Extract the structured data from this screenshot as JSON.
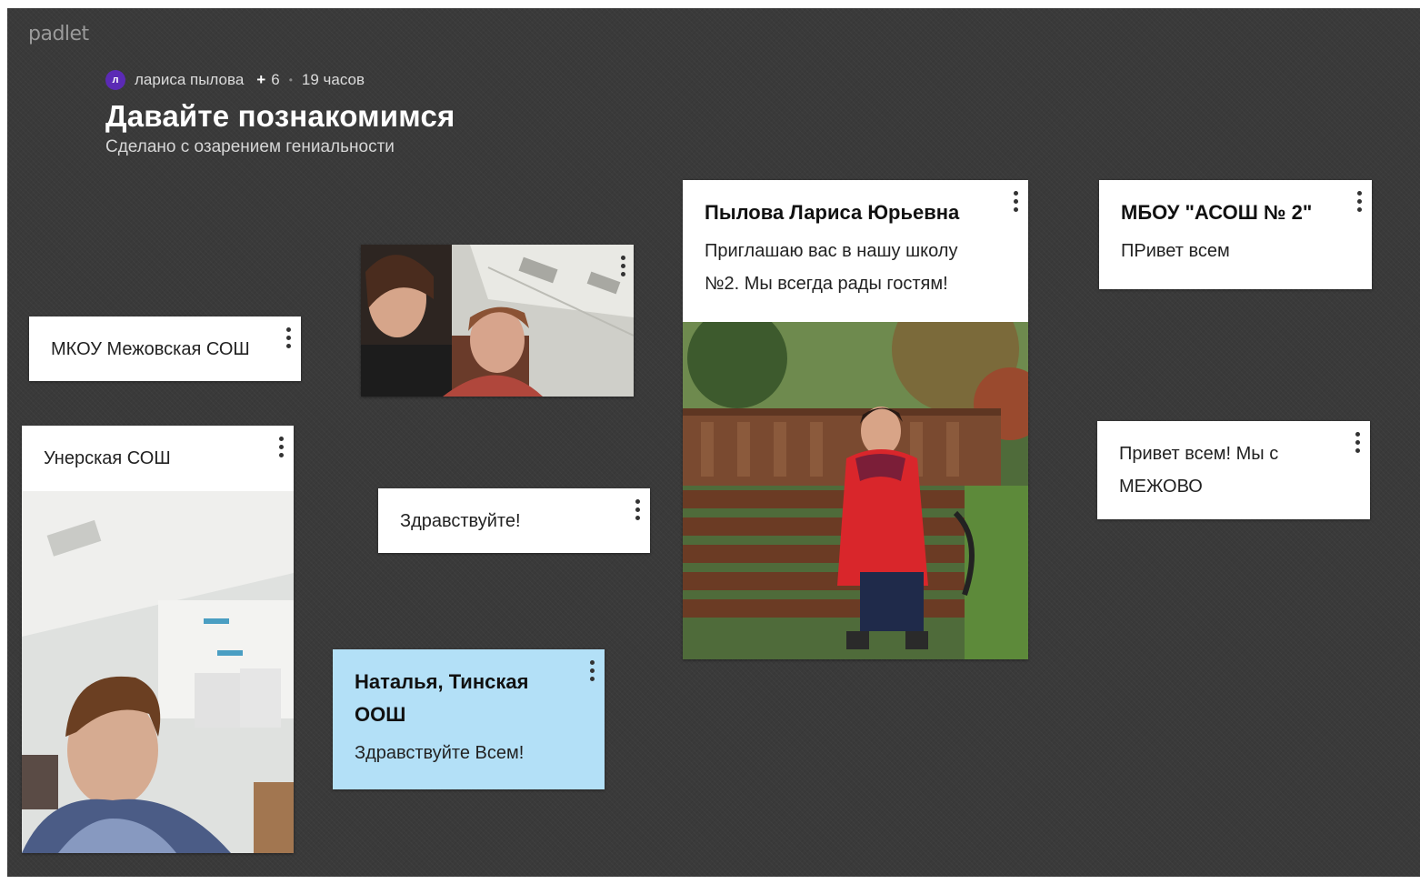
{
  "app": {
    "logo": "padlet"
  },
  "header": {
    "avatar_letter": "л",
    "author": "лариса пылова",
    "plus": "+",
    "contributors": "6",
    "separator": "•",
    "time_ago": "19 часов",
    "title": "Давайте познакомимся",
    "subtitle": "Сделано с озарением гениальности"
  },
  "posts": {
    "mkou": {
      "text": "МКОУ Межовская СОШ"
    },
    "unerskaya": {
      "text": "Унерская СОШ"
    },
    "zdravstvuyte": {
      "text": "Здравствуйте!"
    },
    "natalya": {
      "title": "Наталья, Тинская ООШ",
      "text": "Здравствуйте Всем!"
    },
    "pylova": {
      "title": "Пылова Лариса Юрьевна",
      "text": "Приглашаю вас  в нашу школу №2. Мы всегда рады  гостям!"
    },
    "mboy": {
      "title": "МБОУ \"АСОШ № 2\"",
      "text": "ПРивет всем"
    },
    "mezhovo": {
      "text": "Привет всем! Мы с МЕЖОВО"
    }
  },
  "colors": {
    "board_bg": "#3a3a3a",
    "card_bg": "#ffffff",
    "card_blue": "#b3e0f7",
    "avatar": "#5b2ab5"
  },
  "icons": {
    "card_menu": "more-vertical-icon",
    "photo": "photo-icon"
  }
}
